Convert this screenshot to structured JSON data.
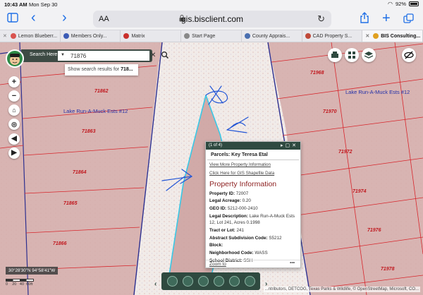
{
  "status_bar": {
    "time": "10:43 AM",
    "date": "Mon Sep 30",
    "battery": "92%"
  },
  "browser": {
    "aa_label": "AA",
    "url": "gis.bisclient.com"
  },
  "tabs": [
    {
      "label": "Lemon Blueberr...",
      "color": "#d9534f"
    },
    {
      "label": "Members Only...",
      "color": "#3b5bb5"
    },
    {
      "label": "Matrix",
      "color": "#c9302c"
    },
    {
      "label": "Start Page",
      "color": "#888888"
    },
    {
      "label": "County Apprais...",
      "color": "#4a6fb0"
    },
    {
      "label": "CAD Property S...",
      "color": "#c04a3a"
    },
    {
      "label": "BIS Consulting...",
      "color": "#e0a020",
      "active": true
    }
  ],
  "search": {
    "label": "Search Here",
    "value": "71876",
    "suggestion_prefix": "Show search results for ",
    "suggestion_term": "718..."
  },
  "map": {
    "parcels": [
      "71862",
      "71863",
      "71864",
      "71865",
      "71866",
      "71968",
      "71970",
      "71972",
      "71974",
      "71976",
      "71978"
    ],
    "subdivisions": [
      "Lake Run-A-Muck Ests #12",
      "Lake Run-A-Muck Ests #12"
    ],
    "coordinates": "30°28'30\"N 94°58'41\"W",
    "scale_labels": [
      "0",
      "20",
      "40",
      "60ft"
    ],
    "attribution": "...ntributors, DETCOG, Texas Parks & Wildlife, © OpenStreetMap, Microsoft, CO..."
  },
  "popup": {
    "counter": "(1 of 4)",
    "title": "Parcels: Key Teresa Etal",
    "link_more": "View More Property Information",
    "link_shapefile": "Click Here for GIS Shapefile Data",
    "heading": "Property Information",
    "rows": [
      {
        "label": "Property ID:",
        "value": "72007"
      },
      {
        "label": "Legal Acreage:",
        "value": "0.20"
      },
      {
        "label": "GEO ID:",
        "value": "5212-000-2410"
      },
      {
        "label": "Legal Description:",
        "value": "Lake Run-A-Muck Ests 12, Lot 241, Acres 0.1998"
      },
      {
        "label": "Tract or Lot:",
        "value": "241"
      },
      {
        "label": "Abstract Subdivision Code:",
        "value": "S5212"
      },
      {
        "label": "Block:",
        "value": ""
      },
      {
        "label": "Neighborhood Code:",
        "value": "WASS"
      },
      {
        "label": "School District:",
        "value": "SSH"
      }
    ],
    "zoom_label": "Zoom to",
    "more_label": "•••"
  },
  "colors": {
    "toolbar": "#2f4a40",
    "accent": "#1f6fe6",
    "parcel_fill": "#d9b2b0",
    "label_red": "#c0171d"
  }
}
